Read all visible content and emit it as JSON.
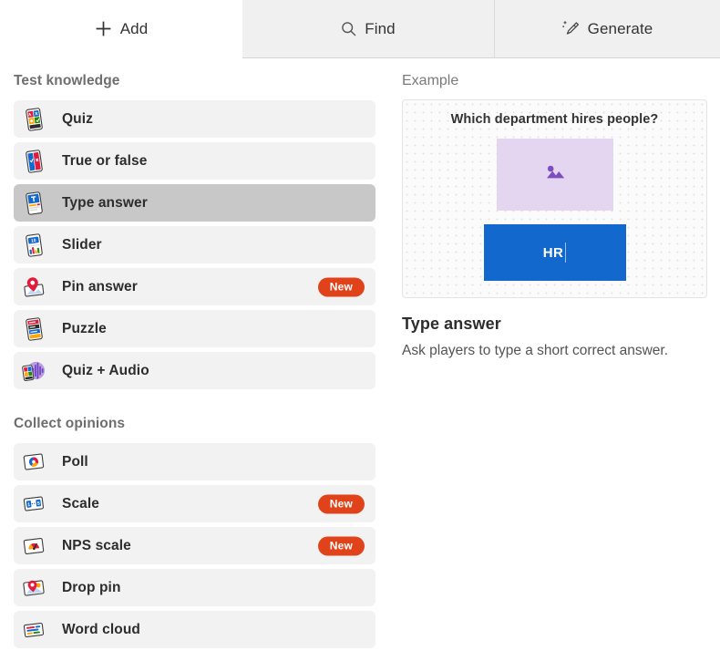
{
  "tabs": [
    {
      "id": "add",
      "label": "Add",
      "icon": "plus-icon",
      "active": true
    },
    {
      "id": "find",
      "label": "Find",
      "icon": "search-icon",
      "active": false
    },
    {
      "id": "generate",
      "label": "Generate",
      "icon": "magic-pencil-icon",
      "active": false
    }
  ],
  "sections": [
    {
      "title": "Test knowledge",
      "items": [
        {
          "label": "Quiz",
          "icon": "quiz-card-icon",
          "badge": "",
          "selected": false
        },
        {
          "label": "True or false",
          "icon": "true-false-card-icon",
          "badge": "",
          "selected": false
        },
        {
          "label": "Type answer",
          "icon": "type-answer-card-icon",
          "badge": "",
          "selected": true
        },
        {
          "label": "Slider",
          "icon": "slider-card-icon",
          "badge": "",
          "selected": false
        },
        {
          "label": "Pin answer",
          "icon": "pin-answer-icon",
          "badge": "New",
          "selected": false
        },
        {
          "label": "Puzzle",
          "icon": "puzzle-card-icon",
          "badge": "",
          "selected": false
        },
        {
          "label": "Quiz + Audio",
          "icon": "quiz-audio-icon",
          "badge": "",
          "selected": false
        }
      ]
    },
    {
      "title": "Collect opinions",
      "items": [
        {
          "label": "Poll",
          "icon": "poll-icon",
          "badge": "",
          "selected": false
        },
        {
          "label": "Scale",
          "icon": "scale-icon",
          "badge": "New",
          "selected": false
        },
        {
          "label": "NPS scale",
          "icon": "nps-scale-icon",
          "badge": "New",
          "selected": false
        },
        {
          "label": "Drop pin",
          "icon": "drop-pin-icon",
          "badge": "",
          "selected": false
        },
        {
          "label": "Word cloud",
          "icon": "word-cloud-icon",
          "badge": "",
          "selected": false
        }
      ]
    }
  ],
  "preview": {
    "example_label": "Example",
    "question": "Which department hires people?",
    "image_placeholder_icon": "image-placeholder-icon",
    "answer_text": "HR",
    "detail_title": "Type answer",
    "detail_description": "Ask players to type a short correct answer."
  },
  "colors": {
    "accent_blue": "#1368ce",
    "badge_orange": "#e0431a",
    "selected_row": "#c8c8c8",
    "row_background": "#f2f2f2",
    "tab_inactive": "#f0f0f0",
    "placeholder_purple": "#e4d5f0",
    "placeholder_icon_purple": "#7c4dbe"
  }
}
